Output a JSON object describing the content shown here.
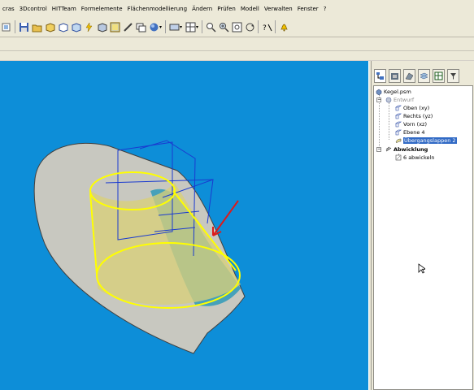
{
  "menu": {
    "items": [
      "cras",
      "3Dcontrol",
      "HITTeam",
      "Formelemente",
      "Flächenmodellierung",
      "Ändern",
      "Prüfen",
      "Modell",
      "Verwalten",
      "Fenster",
      "?"
    ]
  },
  "toolbar": {
    "icons": [
      "part-icon",
      "save-icon",
      "open-icon",
      "cube-icon",
      "cube-outline-icon",
      "feature-icon",
      "lightning-icon",
      "box-icon",
      "shade-icon",
      "material-icon",
      "sphere-icon",
      "view-icon",
      "display-icon",
      "zoom-icon",
      "zoom-area-icon",
      "fit-icon",
      "rotate-icon",
      "help-icon",
      "bell-icon"
    ]
  },
  "panel": {
    "tabs": [
      "feature-tree-tab",
      "library-tab",
      "assembly-tab",
      "layers-tab",
      "teamcenter-tab",
      "family-tab"
    ]
  },
  "tree": {
    "root": "Kegel.psm",
    "entwurf": "Entwurf",
    "planes": [
      "Oben (xy)",
      "Rechts (yz)",
      "Vorn (xz)",
      "Ebene 4"
    ],
    "selected": "Übergangslappen 2",
    "abwicklung": "Abwicklung",
    "abwickeln": "6 abwickeln"
  },
  "colors": {
    "viewport_bg": "#0d8ed8",
    "surface": "#c8c8c0",
    "highlight": "#ffff00",
    "sketch": "#1a3ad0",
    "arrow": "#dd1a1a",
    "selection": "#316ac5"
  }
}
